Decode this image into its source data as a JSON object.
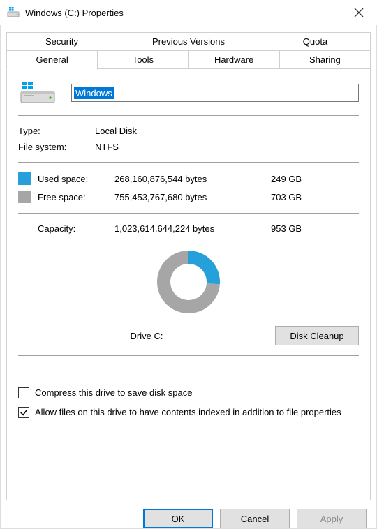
{
  "window": {
    "title": "Windows (C:) Properties"
  },
  "tabs": {
    "row1": [
      "Security",
      "Previous Versions",
      "Quota"
    ],
    "row2": [
      "General",
      "Tools",
      "Hardware",
      "Sharing"
    ],
    "active": "General"
  },
  "volume": {
    "name": "Windows"
  },
  "info": {
    "type_label": "Type:",
    "type_value": "Local Disk",
    "fs_label": "File system:",
    "fs_value": "NTFS"
  },
  "space": {
    "used_label": "Used space:",
    "used_bytes": "268,160,876,544 bytes",
    "used_human": "249 GB",
    "free_label": "Free space:",
    "free_bytes": "755,453,767,680 bytes",
    "free_human": "703 GB",
    "capacity_label": "Capacity:",
    "capacity_bytes": "1,023,614,644,224 bytes",
    "capacity_human": "953 GB"
  },
  "drive_label": "Drive C:",
  "buttons": {
    "cleanup": "Disk Cleanup",
    "ok": "OK",
    "cancel": "Cancel",
    "apply": "Apply"
  },
  "checks": {
    "compress_label": "Compress this drive to save disk space",
    "compress_checked": false,
    "index_label": "Allow files on this drive to have contents indexed in addition to file properties",
    "index_checked": true
  },
  "colors": {
    "used": "#26a0da",
    "free": "#a6a6a6",
    "accent": "#0078d7"
  },
  "chart_data": {
    "type": "pie",
    "title": "Drive C:",
    "series": [
      {
        "name": "Used space",
        "value": 268160876544,
        "human": "249 GB",
        "color": "#26a0da"
      },
      {
        "name": "Free space",
        "value": 755453767680,
        "human": "703 GB",
        "color": "#a6a6a6"
      }
    ],
    "total": {
      "label": "Capacity",
      "value": 1023614644224,
      "human": "953 GB"
    }
  }
}
